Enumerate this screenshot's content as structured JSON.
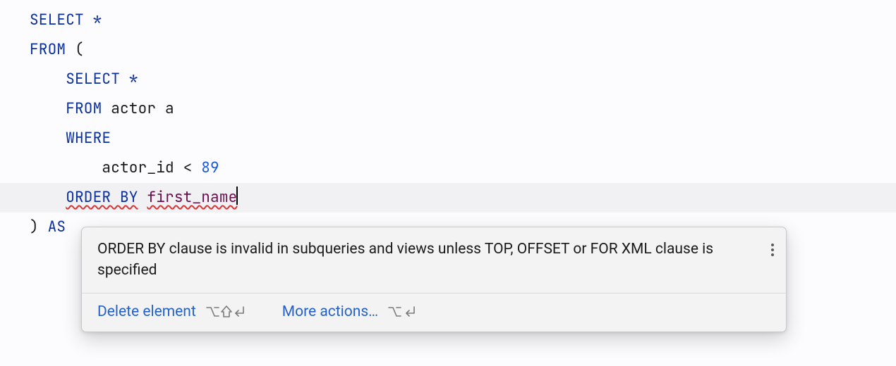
{
  "code": {
    "line1_kw1": "SELECT",
    "line1_star": " *",
    "line2_kw1": "FROM",
    "line2_paren": " (",
    "line3_indent": "    ",
    "line3_kw1": "SELECT",
    "line3_star": " *",
    "line4_indent": "    ",
    "line4_kw1": "FROM",
    "line4_ident": " actor a",
    "line5_indent": "    ",
    "line5_kw1": "WHERE",
    "line6_indent": "        ",
    "line6_ident": "actor_id ",
    "line6_op": "<",
    "line6_sp": " ",
    "line6_num": "89",
    "line7_indent": "    ",
    "line7_kw1": "ORDER BY",
    "line7_sp": " ",
    "line7_ident": "first_name",
    "line8_close": ") ",
    "line8_kw1": "AS"
  },
  "popup": {
    "message": "ORDER BY clause is invalid in subqueries and views unless TOP, OFFSET or FOR XML clause is specified",
    "action1_label": "Delete element",
    "action1_shortcut_text": "⌥⇧⏎",
    "action2_label": "More actions…",
    "action2_shortcut_text": "⌥⏎"
  }
}
